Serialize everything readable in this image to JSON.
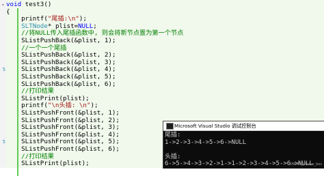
{
  "editor": {
    "line_numbers": [
      "",
      "",
      "",
      "",
      "",
      "",
      "",
      "",
      "",
      "5",
      "",
      "",
      "",
      "",
      "",
      "",
      "",
      "",
      "",
      "5",
      "",
      "",
      "",
      ""
    ],
    "lines": [
      {
        "parts": [
          {
            "cls": "kw",
            "text": "void"
          },
          {
            "cls": "",
            "text": " test3()"
          }
        ]
      },
      {
        "parts": [
          {
            "cls": "",
            "text": "{"
          }
        ]
      },
      {
        "parts": [
          {
            "cls": "",
            "text": "    printf("
          },
          {
            "cls": "str",
            "text": "\"尾插:\\n\""
          },
          {
            "cls": "",
            "text": ");"
          }
        ]
      },
      {
        "parts": [
          {
            "cls": "",
            "text": "    "
          },
          {
            "cls": "ty",
            "text": "SLTNode"
          },
          {
            "cls": "",
            "text": "* plist="
          },
          {
            "cls": "kw",
            "text": "NULL"
          },
          {
            "cls": "",
            "text": ";"
          }
        ]
      },
      {
        "parts": [
          {
            "cls": "cm",
            "text": "    //将NULL传入尾插函数中, 则会将新节点置为第一个节点"
          }
        ]
      },
      {
        "parts": [
          {
            "cls": "",
            "text": "    SListPushBack(&plist, 1);"
          }
        ]
      },
      {
        "parts": [
          {
            "cls": "cm",
            "text": "    //一个一个尾插"
          }
        ]
      },
      {
        "parts": [
          {
            "cls": "",
            "text": "    SListPushBack(&plist, 2);"
          }
        ]
      },
      {
        "parts": [
          {
            "cls": "",
            "text": "    SListPushBack(&plist, 3);"
          }
        ]
      },
      {
        "parts": [
          {
            "cls": "",
            "text": "    SListPushBack(&plist, 4);"
          }
        ]
      },
      {
        "parts": [
          {
            "cls": "",
            "text": "    SListPushBack(&plist, 5);"
          }
        ]
      },
      {
        "parts": [
          {
            "cls": "",
            "text": "    SListPushBack(&plist, 6);"
          }
        ]
      },
      {
        "parts": [
          {
            "cls": "cm",
            "text": "    //打印结果"
          }
        ]
      },
      {
        "parts": [
          {
            "cls": "",
            "text": "    SListPrint(plist);"
          }
        ]
      },
      {
        "parts": [
          {
            "cls": "",
            "text": "    printf("
          },
          {
            "cls": "str",
            "text": "\"\\n头插: \\n\""
          },
          {
            "cls": "",
            "text": ");"
          }
        ]
      },
      {
        "parts": [
          {
            "cls": "",
            "text": "    SListPushFront(&plist, 1);"
          }
        ]
      },
      {
        "parts": [
          {
            "cls": "",
            "text": "    SListPushFront(&plist, 2);"
          }
        ]
      },
      {
        "parts": [
          {
            "cls": "",
            "text": "    SListPushFront(&plist, 3);"
          }
        ]
      },
      {
        "parts": [
          {
            "cls": "",
            "text": "    SListPushFront(&plist, 4);"
          }
        ]
      },
      {
        "parts": [
          {
            "cls": "",
            "text": "    SListPushFront(&plist, 5);"
          }
        ]
      },
      {
        "parts": [
          {
            "cls": "",
            "text": "    SListPushFront(&plist, 6);"
          }
        ]
      },
      {
        "parts": [
          {
            "cls": "cm",
            "text": "    //打印结果"
          }
        ]
      },
      {
        "parts": [
          {
            "cls": "",
            "text": "    SListPrint(plist);"
          }
        ]
      }
    ]
  },
  "console": {
    "title": "Microsoft Visual Studio 调试控制台",
    "lines": [
      "尾插:",
      "1->2->3->4->5->6->NULL",
      "",
      "头插:",
      "6->5->4->3->2->1->1->2->3->4->5->6->NULL"
    ]
  },
  "watermark": "CSDN @Brave_bes"
}
